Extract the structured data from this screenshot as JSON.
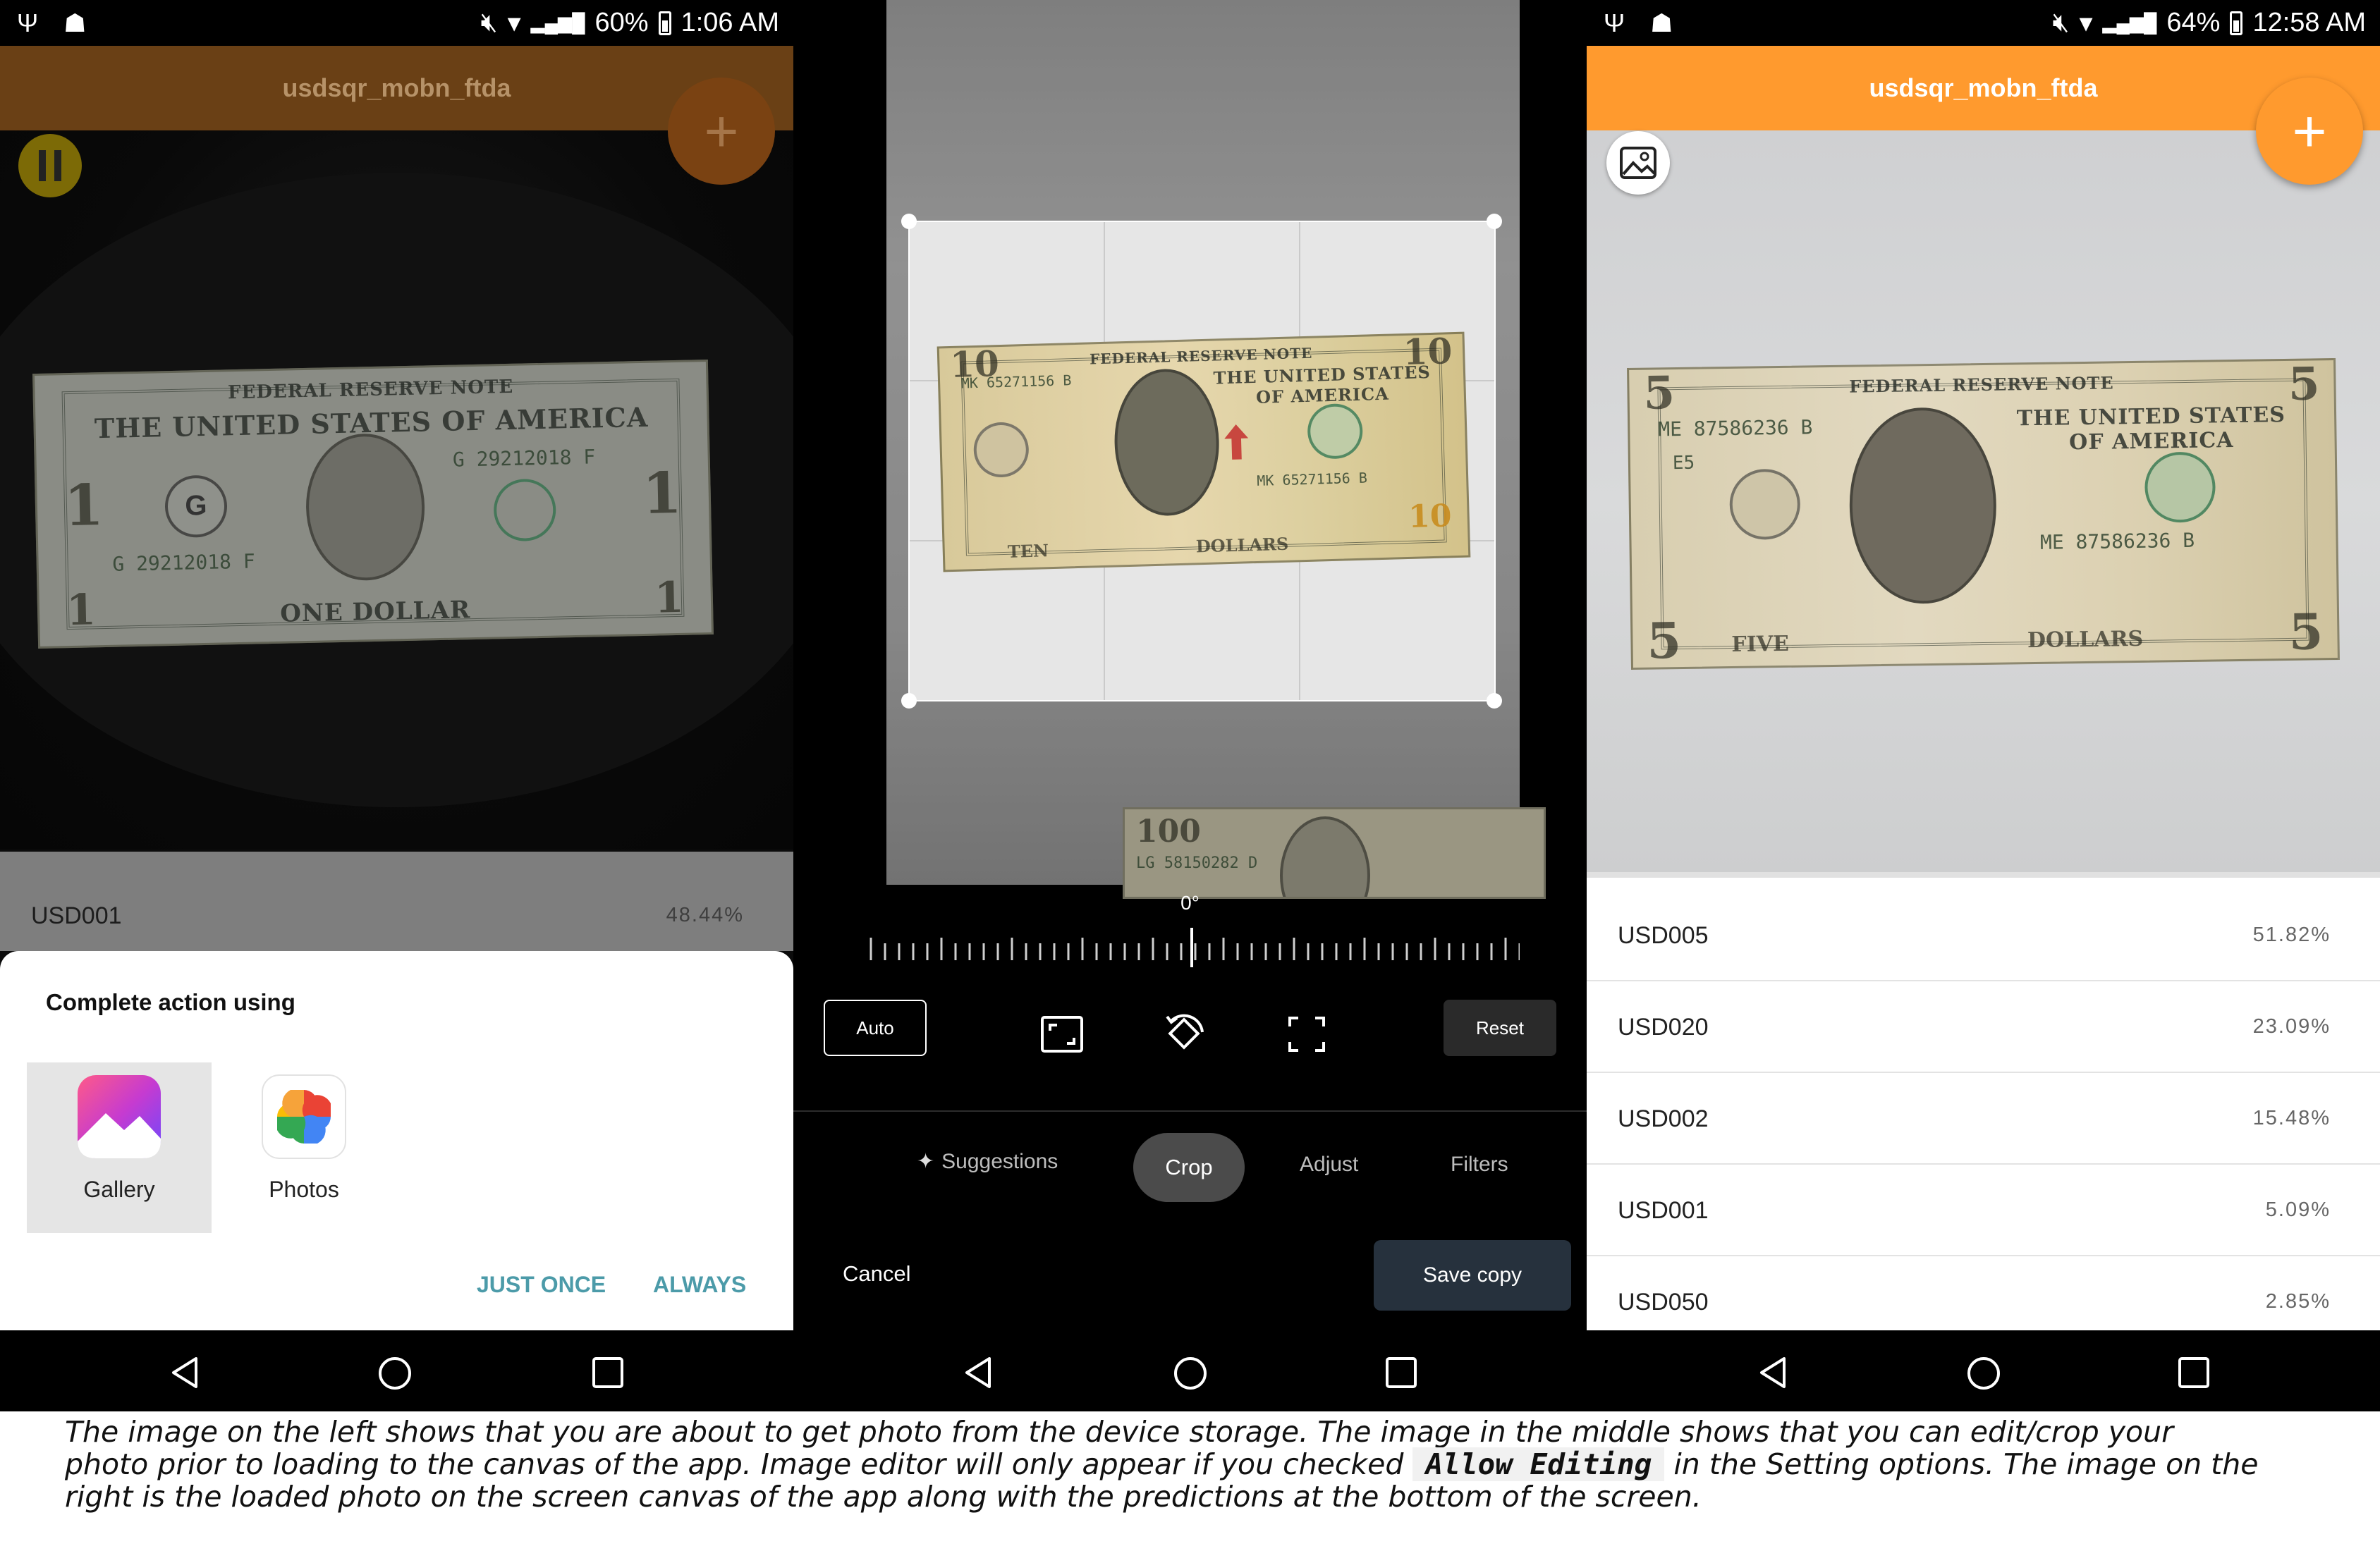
{
  "left": {
    "status": {
      "time": "1:06 AM",
      "battery": "60%"
    },
    "app_title": "usdsqr_mobn_ftda",
    "prediction": {
      "label": "USD001",
      "confidence": "48.44%"
    },
    "bill": {
      "header": "FEDERAL RESERVE NOTE",
      "country": "THE UNITED STATES OF AMERICA",
      "serial": "G 29212018 F",
      "denomination": "1",
      "bottom_text": "ONE DOLLAR",
      "letter": "G"
    },
    "dialog": {
      "title": "Complete action using",
      "apps": [
        {
          "label": "Gallery",
          "icon": "gallery-icon"
        },
        {
          "label": "Photos",
          "icon": "photos-pinwheel-icon"
        }
      ],
      "just_once": "JUST ONCE",
      "always": "ALWAYS"
    }
  },
  "middle": {
    "angle": "0°",
    "auto": "Auto",
    "reset": "Reset",
    "tabs": [
      "Suggestions",
      "Crop",
      "Adjust",
      "Filters"
    ],
    "active_tab": "Crop",
    "cancel": "Cancel",
    "save": "Save copy",
    "bill": {
      "header": "FEDERAL RESERVE NOTE",
      "country": "THE UNITED STATES OF AMERICA",
      "serial": "MK 65271156 B",
      "denomination": "10",
      "left_text": "TEN",
      "right_text": "DOLLARS",
      "bg_denomination": "100",
      "bg_serial": "LG 58150282 D"
    }
  },
  "right": {
    "status": {
      "time": "12:58 AM",
      "battery": "64%"
    },
    "app_title": "usdsqr_mobn_ftda",
    "bill": {
      "header": "FEDERAL RESERVE NOTE",
      "country": "THE UNITED STATES OF AMERICA",
      "serial": "ME 87586236 B",
      "denomination": "5",
      "left_text": "FIVE",
      "right_text": "DOLLARS",
      "code": "E5"
    },
    "predictions": [
      {
        "label": "USD005",
        "confidence": "51.82%"
      },
      {
        "label": "USD020",
        "confidence": "23.09%"
      },
      {
        "label": "USD002",
        "confidence": "15.48%"
      },
      {
        "label": "USD001",
        "confidence": "5.09%"
      },
      {
        "label": "USD050",
        "confidence": "2.85%"
      }
    ]
  },
  "caption": {
    "part1": "The image on the left shows that you are about to get photo from the device storage. The image in the middle shows that you can edit/crop your photo prior to loading to the canvas of the app. Image editor will only appear if you checked",
    "code": "Allow Editing",
    "part2": "in the Setting options. The image on the right is the loaded photo on the screen canvas of the app along with the predictions at the bottom of the screen."
  },
  "colors": {
    "accent_orange": "#FF9A2E",
    "dim_orange": "#7A4A15",
    "dialog_button": "#4C9BA9",
    "dark_button": "#26313D"
  }
}
